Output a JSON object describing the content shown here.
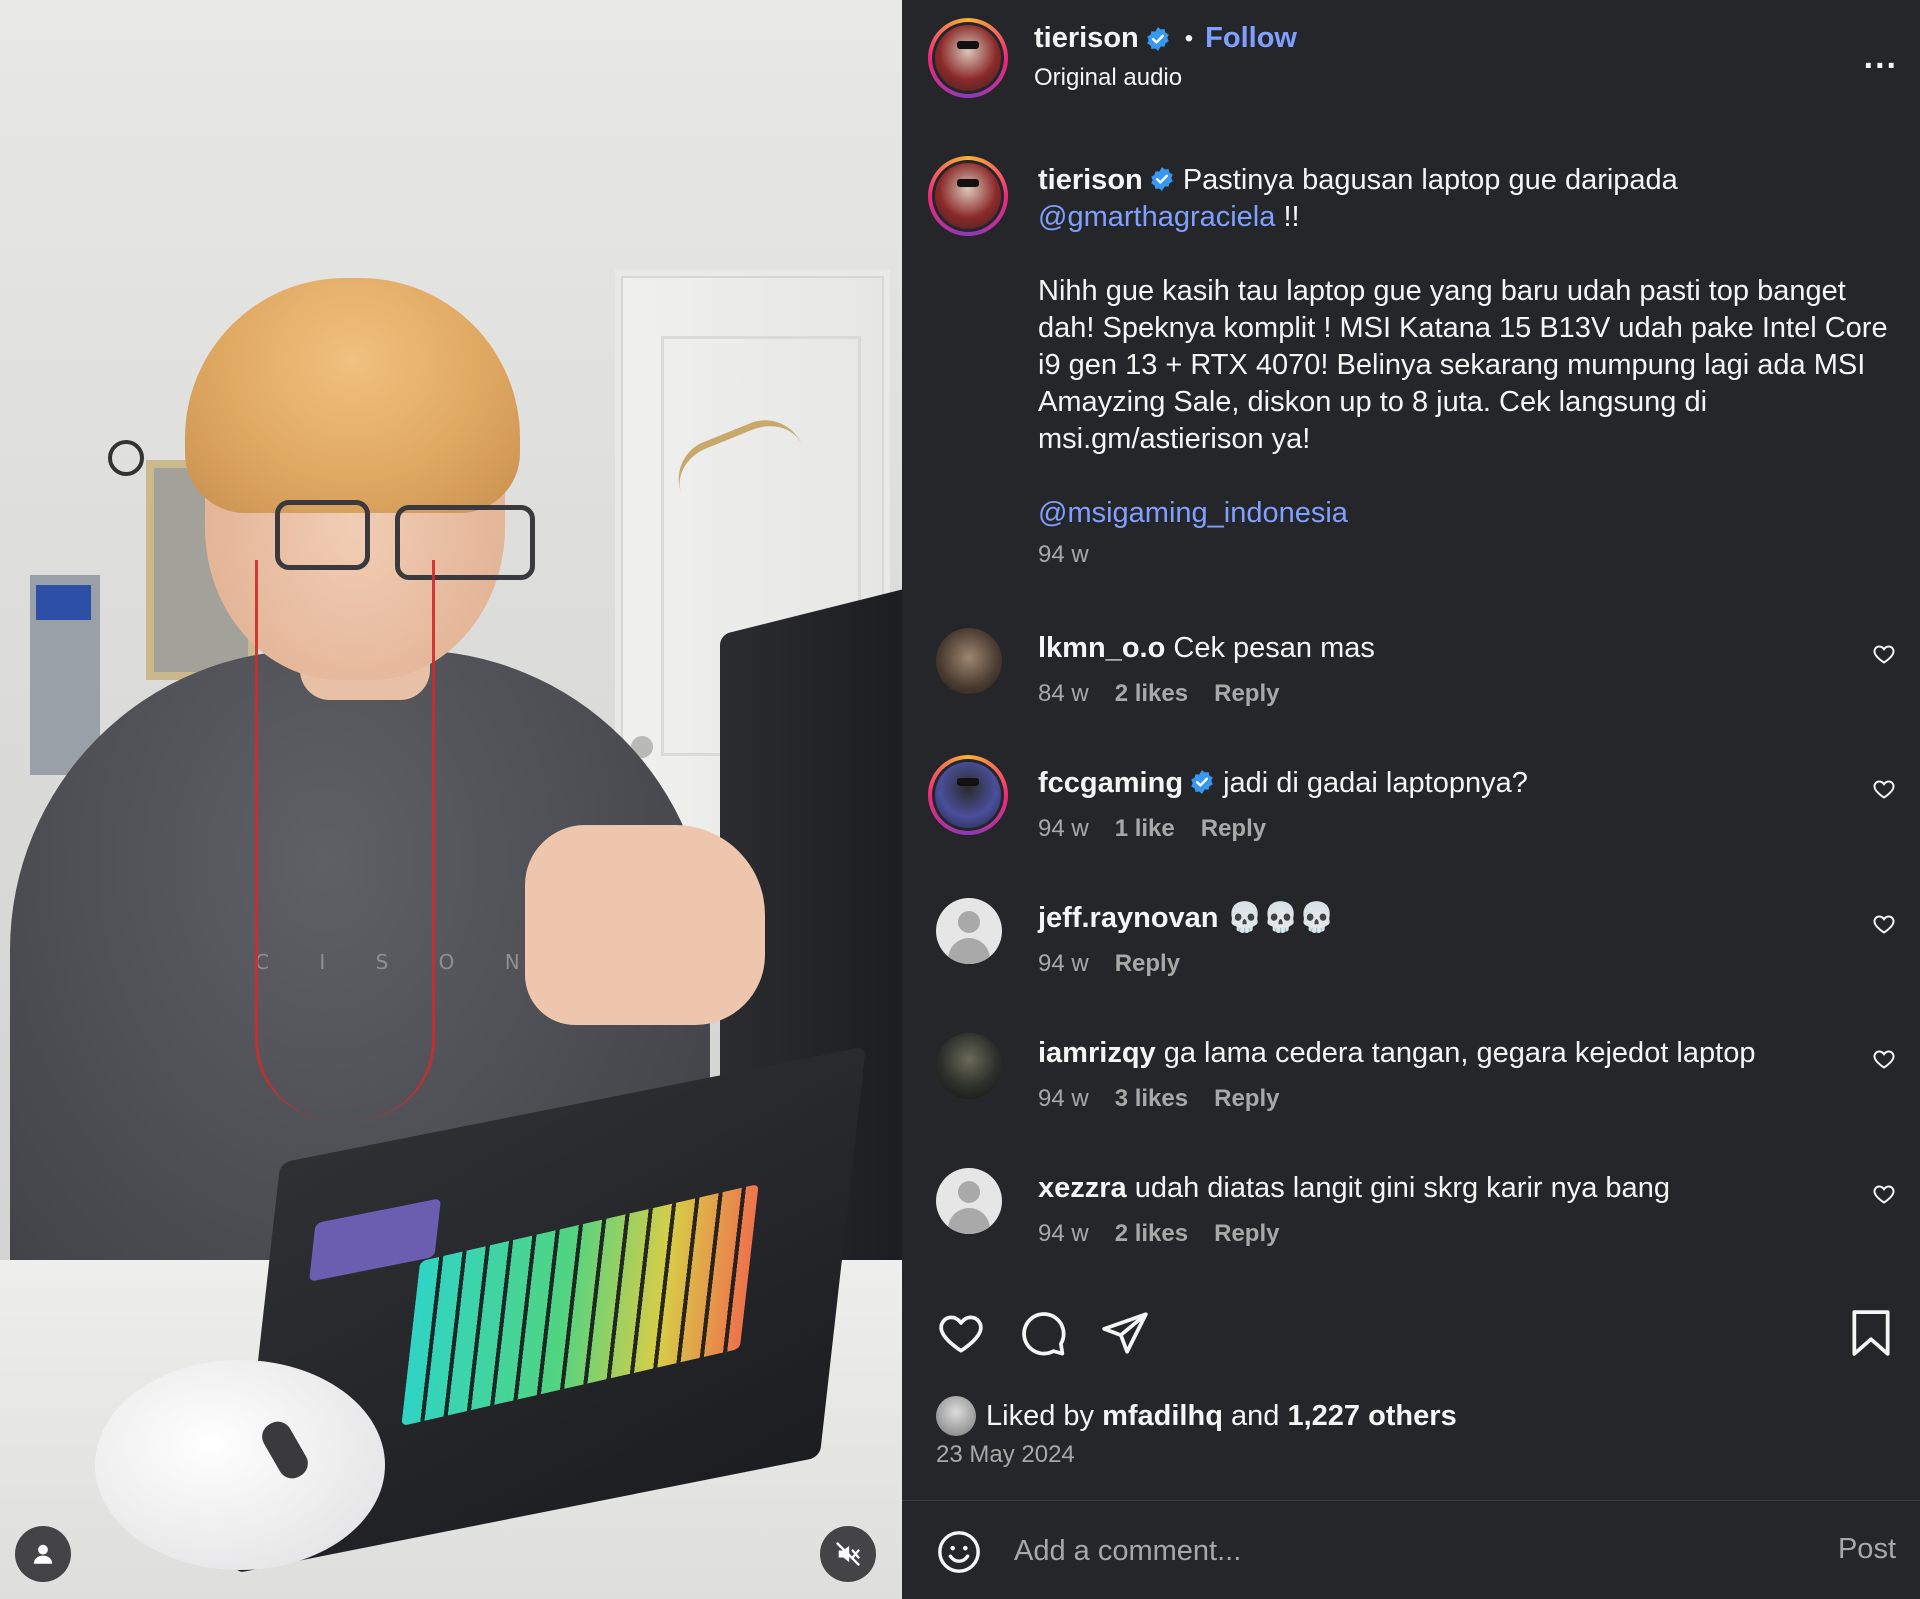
{
  "post": {
    "author": "tierison",
    "follow_label": "Follow",
    "separator": "•",
    "audio": "Original audio",
    "more": "..."
  },
  "caption": {
    "author": "tierison",
    "line1": "Pastinya bagusan laptop gue daripada",
    "mention1": "@gmarthagraciela",
    "exclaim": " !!",
    "body": "Nihh gue kasih tau laptop gue yang baru udah pasti top banget dah! Speknya komplit ! MSI Katana 15 B13V udah pake Intel Core i9 gen 13 + RTX 4070! Belinya sekarang mumpung lagi ada MSI Amayzing Sale, diskon up to 8 juta. Cek langsung di msi.gm/astierison ya!",
    "mention2": "@msigaming_indonesia",
    "age": "94 w"
  },
  "comments": [
    {
      "user": "lkmn_o.o",
      "text": "Cek pesan mas",
      "age": "84 w",
      "likes": "2 likes",
      "reply": "Reply"
    },
    {
      "user": "fccgaming",
      "text": "jadi di gadai laptopnya?",
      "age": "94 w",
      "likes": "1 like",
      "reply": "Reply"
    },
    {
      "user": "jeff.raynovan",
      "text": "💀💀💀",
      "age": "94 w",
      "likes": "",
      "reply": "Reply"
    },
    {
      "user": "iamrizqy",
      "text": "ga lama cedera tangan, gegara kejedot laptop",
      "age": "94 w",
      "likes": "3 likes",
      "reply": "Reply"
    },
    {
      "user": "xezzra",
      "text": "udah diatas langit gini skrg karir nya bang",
      "age": "94 w",
      "likes": "2 likes",
      "reply": "Reply"
    }
  ],
  "likes_summary": {
    "prefix": "Liked by",
    "user": "mfadilhq",
    "middle": "and",
    "others": "1,227 others"
  },
  "date": "23 May 2024",
  "comment_box": {
    "placeholder": "Add a comment...",
    "post_label": "Post"
  },
  "media": {
    "shirt_text": "C I S   O N"
  },
  "colors": {
    "panel_bg": "#25262a",
    "link_blue": "#7fa0ff",
    "muted": "#a8a8a8",
    "verified": "#3897f0"
  },
  "icons": [
    "user-icon",
    "mute-icon",
    "verified-icon",
    "heart-icon",
    "comment-icon",
    "share-icon",
    "bookmark-icon",
    "emoji-icon",
    "more-icon"
  ]
}
